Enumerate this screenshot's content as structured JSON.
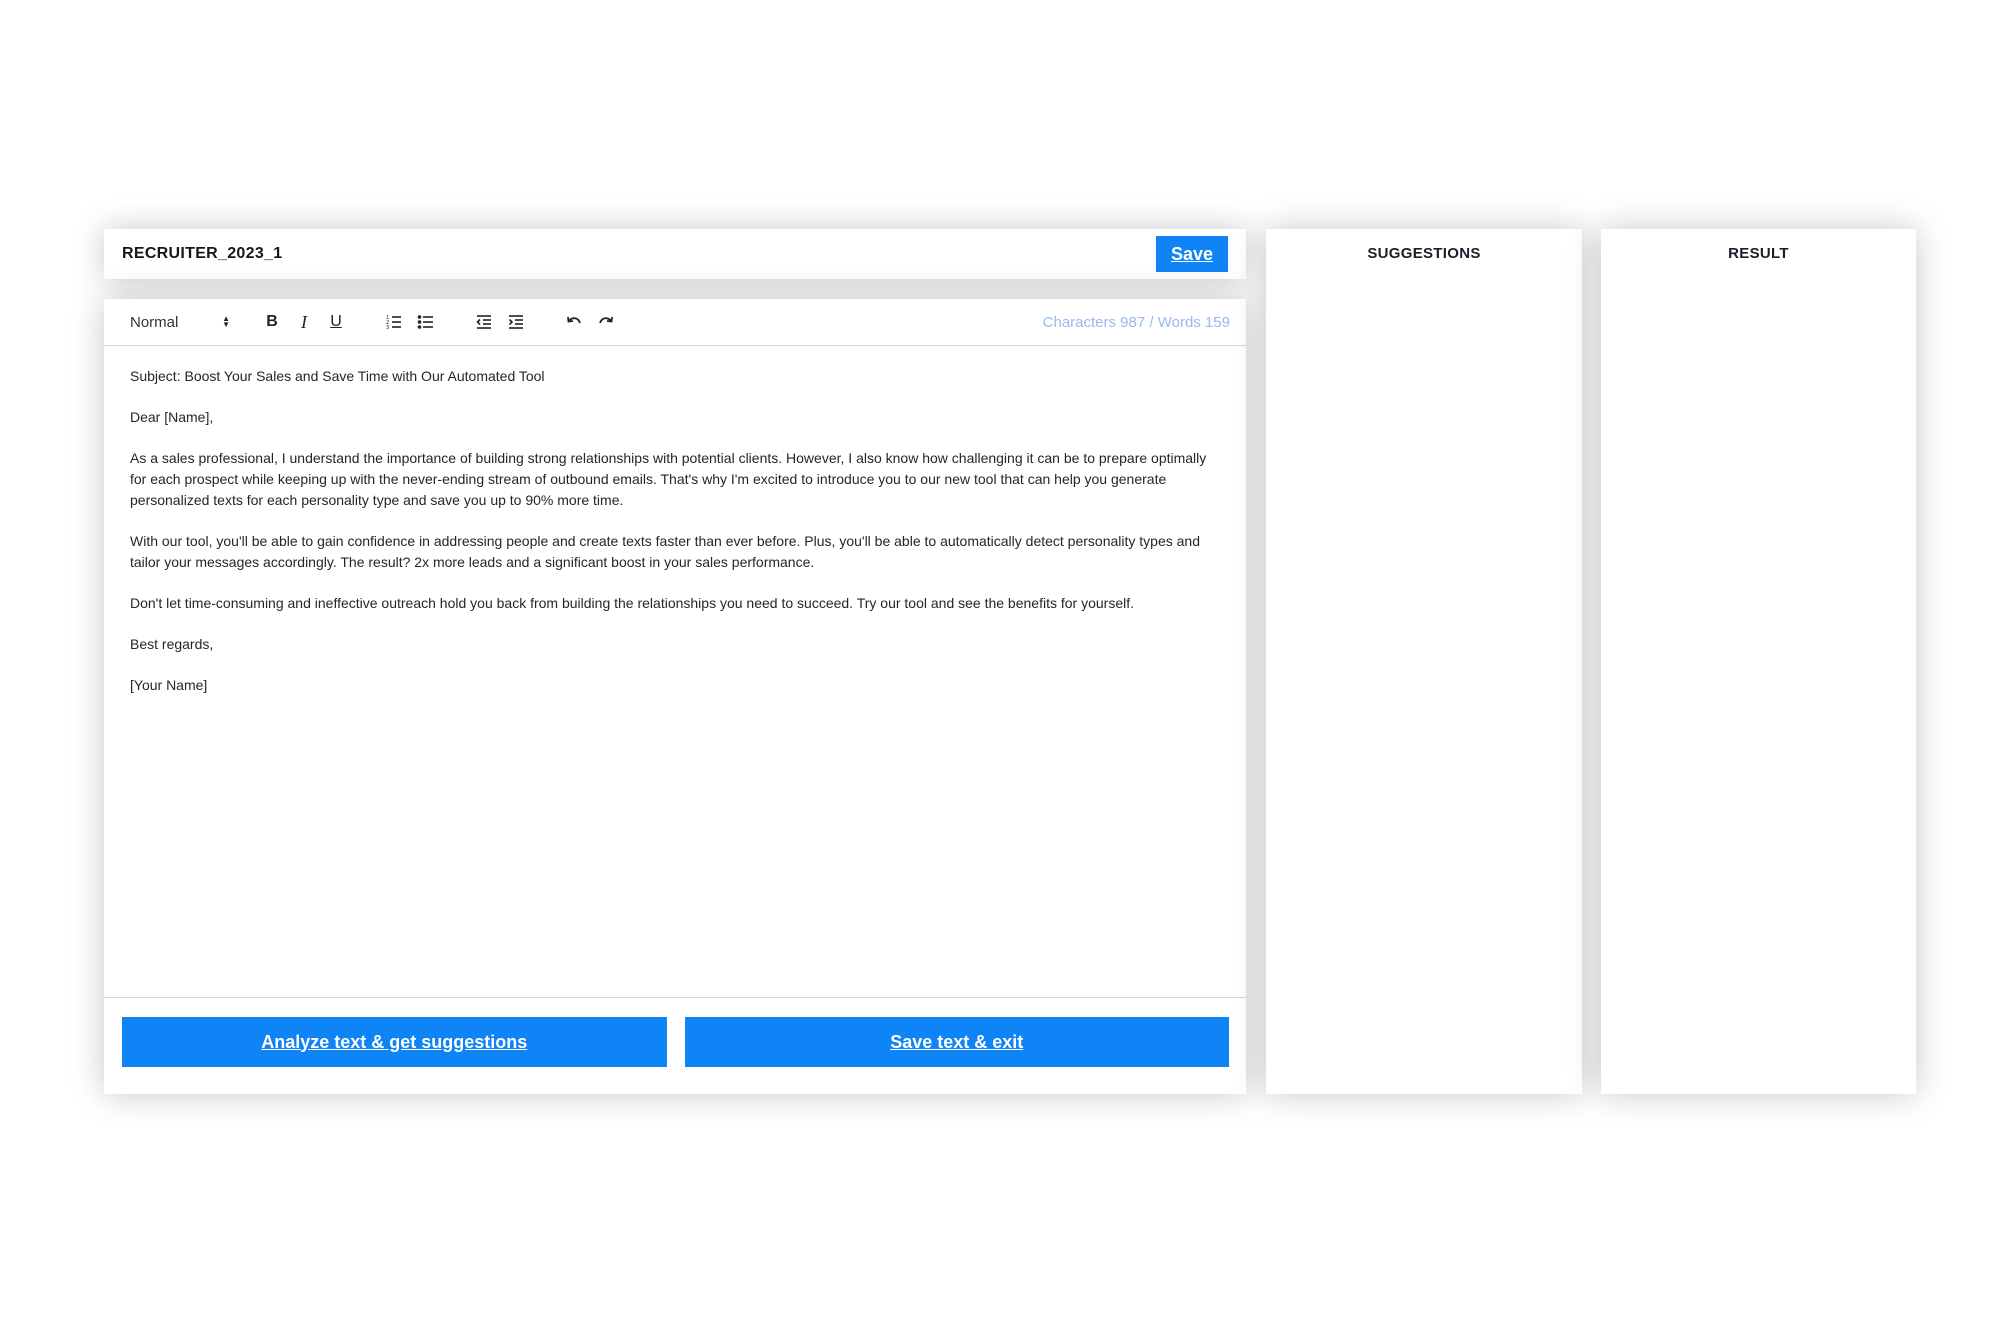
{
  "document": {
    "title": "RECRUITER_2023_1",
    "save_label": "Save"
  },
  "toolbar": {
    "format_value": "Normal",
    "buttons": {
      "bold": "B",
      "italic": "I",
      "underline": "U"
    },
    "icons": [
      "bold-icon",
      "italic-icon",
      "underline-icon",
      "ordered-list-icon",
      "bullet-list-icon",
      "outdent-icon",
      "indent-icon",
      "undo-icon",
      "redo-icon"
    ],
    "counter": {
      "characters_label": "Characters",
      "characters": "987",
      "separator": "/",
      "words_label": "Words",
      "words": "159"
    }
  },
  "editor": {
    "paragraphs": [
      "Subject: Boost Your Sales and Save Time with Our Automated Tool",
      "Dear [Name],",
      "As a sales professional, I understand the importance of building strong relationships with potential clients. However, I also know how challenging it can be to prepare optimally for each prospect while keeping up with the never-ending stream of outbound emails. That's why I'm excited to introduce you to our new tool that can help you generate personalized texts for each personality type and save you up to 90% more time.",
      "With our tool, you'll be able to gain confidence in addressing people and create texts faster than ever before. Plus, you'll be able to automatically detect personality types and tailor your messages accordingly. The result? 2x more leads and a significant boost in your sales performance.",
      "Don't let time-consuming and ineffective outreach hold you back from building the relationships you need to succeed. Try our tool and see the benefits for yourself.",
      "Best regards,",
      "[Your Name]"
    ]
  },
  "actions": {
    "analyze_label": "Analyze text & get suggestions",
    "save_exit_label": "Save text & exit"
  },
  "side_panels": {
    "suggestions_title": "SUGGESTIONS",
    "result_title": "RESULT"
  },
  "colors": {
    "accent": "#0f84f7",
    "counter_text": "#9ab8ef"
  }
}
